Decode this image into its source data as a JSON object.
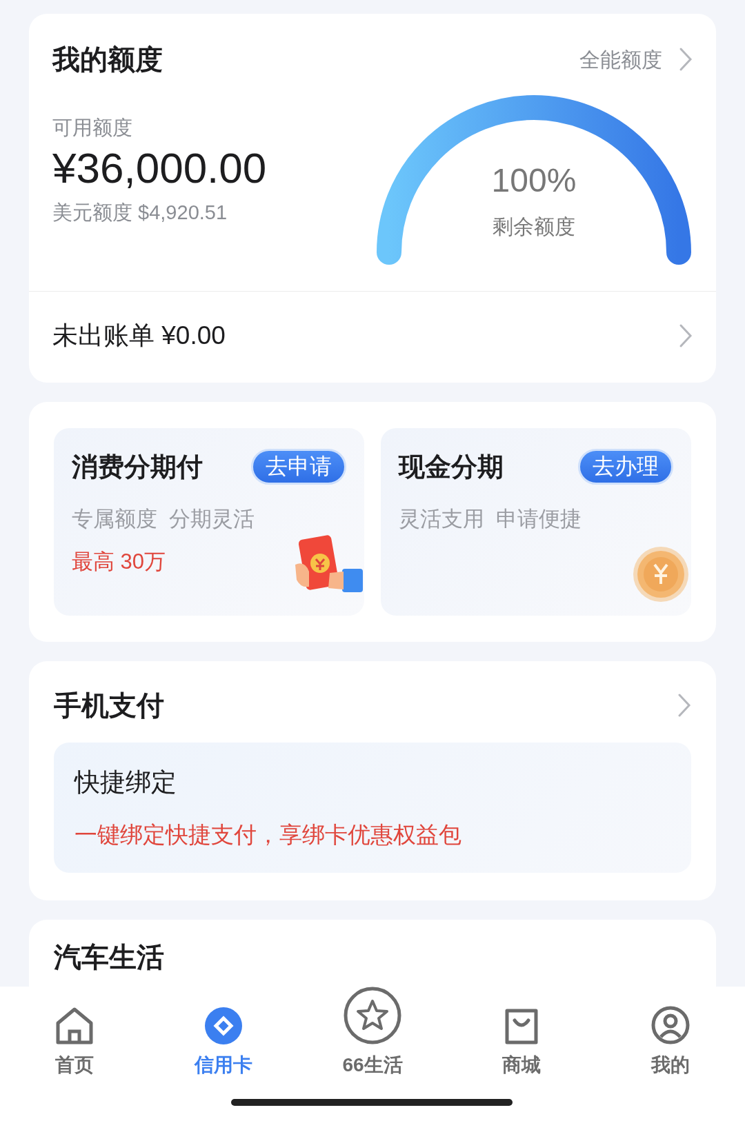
{
  "quota": {
    "title": "我的额度",
    "link": "全能额度",
    "available_label": "可用额度",
    "amount": "¥36,000.00",
    "usd": "美元额度 $4,920.51",
    "gauge": {
      "value": "100%",
      "label": "剩余额度"
    },
    "unbilled": "未出账单 ¥0.00"
  },
  "installments": [
    {
      "kind": "hand",
      "title": "消费分期付",
      "button": "去申请",
      "subtitle": "专属额度  分期灵活",
      "highlight": "最高 30万"
    },
    {
      "kind": "coin",
      "title": "现金分期",
      "button": "去办理",
      "subtitle": "灵活支用  申请便捷"
    }
  ],
  "mobile_pay": {
    "title": "手机支付",
    "card_title": "快捷绑定",
    "promo": "一键绑定快捷支付，享绑卡优惠权益包"
  },
  "next_section": {
    "title": "汽车生活"
  },
  "tabs": [
    {
      "kind": "home",
      "label": "首页",
      "selected": false
    },
    {
      "kind": "card",
      "label": "信用卡",
      "selected": true
    },
    {
      "kind": "star",
      "label": "66生活",
      "selected": false
    },
    {
      "kind": "bag",
      "label": "商城",
      "selected": false
    },
    {
      "kind": "person",
      "label": "我的",
      "selected": false
    }
  ]
}
